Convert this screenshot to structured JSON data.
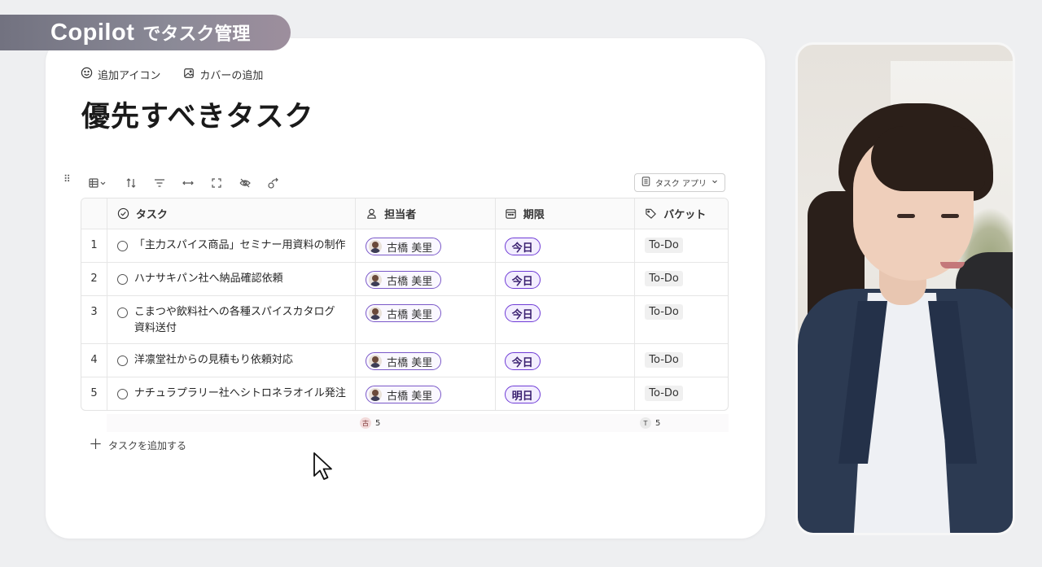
{
  "banner": {
    "brand": "Copilot",
    "subtitle": "でタスク管理"
  },
  "page": {
    "actions": [
      {
        "label": "追加アイコン",
        "icon": "smiley-icon"
      },
      {
        "label": "カバーの追加",
        "icon": "image-icon"
      }
    ],
    "title": "優先すべきタスク"
  },
  "toolbar": {
    "source_label": "タスク アプリ"
  },
  "table": {
    "columns": [
      {
        "key": "task",
        "label": "タスク",
        "icon": "check-circle-icon"
      },
      {
        "key": "owner",
        "label": "担当者",
        "icon": "person-icon"
      },
      {
        "key": "due",
        "label": "期限",
        "icon": "calendar-icon"
      },
      {
        "key": "bucket",
        "label": "バケット",
        "icon": "tag-icon"
      }
    ],
    "rows": [
      {
        "num": "1",
        "task": "「主力スパイス商品」セミナー用資料の制作",
        "owner": "古橋 美里",
        "due": "今日",
        "bucket": "To-Do"
      },
      {
        "num": "2",
        "task": "ハナサキパン社へ納品確認依頼",
        "owner": "古橋 美里",
        "due": "今日",
        "bucket": "To-Do"
      },
      {
        "num": "3",
        "task": "こまつや飲料社への各種スパイスカタログ資料送付",
        "owner": "古橋 美里",
        "due": "今日",
        "bucket": "To-Do"
      },
      {
        "num": "4",
        "task": "洋凛堂社からの見積もり依頼対応",
        "owner": "古橋 美里",
        "due": "今日",
        "bucket": "To-Do"
      },
      {
        "num": "5",
        "task": "ナチュラプラリー社へシトロネラオイル発注",
        "owner": "古橋 美里",
        "due": "明日",
        "bucket": "To-Do"
      }
    ]
  },
  "summary": {
    "owner_badge": "古",
    "owner_count": "5",
    "bucket_badge": "T",
    "bucket_count": "5"
  },
  "add_task_label": "タスクを追加する",
  "colors": {
    "accent_purple": "#6f3bd6",
    "card_bg": "#ffffff",
    "page_bg": "#eeeff1"
  }
}
